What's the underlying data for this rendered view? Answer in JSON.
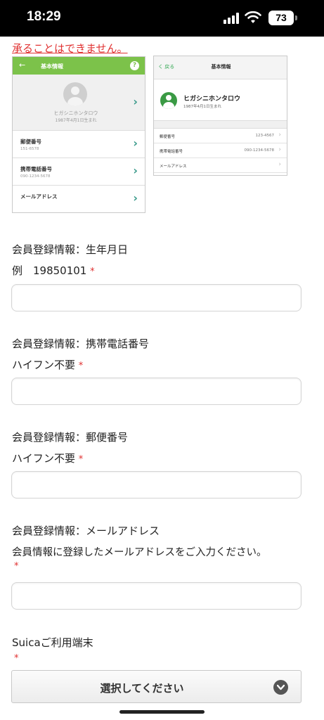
{
  "status_bar": {
    "time": "18:29",
    "battery": "73"
  },
  "notice": {
    "text": "承ることはできません。"
  },
  "screenshot_android": {
    "back_icon": "←",
    "title": "基本情報",
    "help_icon": "?",
    "profile_name": "ヒガシニホンタロウ",
    "profile_birth": "1987年4月1日生まれ",
    "rows": [
      {
        "label": "郵便番号",
        "value": "151-6578"
      },
      {
        "label": "携帯電話番号",
        "value": "090-1234-5678"
      },
      {
        "label": "メールアドレス",
        "value": ""
      }
    ]
  },
  "screenshot_ios": {
    "back_label": "く 戻る",
    "title": "基本情報",
    "profile_name": "ヒガシニホンタロウ",
    "profile_birth": "1987年4月1日生まれ",
    "rows": [
      {
        "label": "郵便番号",
        "value": "123-4567"
      },
      {
        "label": "携帯電話番号",
        "value": "090-1234-5678"
      },
      {
        "label": "メールアドレス",
        "value": ""
      }
    ]
  },
  "form": {
    "birthdate": {
      "label": "会員登録情報：生年月日",
      "hint": "例　19850101",
      "required": "*",
      "value": ""
    },
    "phone": {
      "label": "会員登録情報：携帯電話番号",
      "hint": "ハイフン不要",
      "required": "*",
      "value": ""
    },
    "postal": {
      "label": "会員登録情報：郵便番号",
      "hint": "ハイフン不要",
      "required": "*",
      "value": ""
    },
    "email": {
      "label": "会員登録情報：メールアドレス",
      "hint": "会員情報に登録したメールアドレスをご入力ください。",
      "required": "*",
      "value": ""
    },
    "device": {
      "label": "Suicaご利用端末",
      "required": "*",
      "select_text": "選択してください"
    }
  },
  "colors": {
    "required": "#e03030",
    "android_header": "#7cc24a",
    "ios_avatar": "#3a9a44"
  }
}
